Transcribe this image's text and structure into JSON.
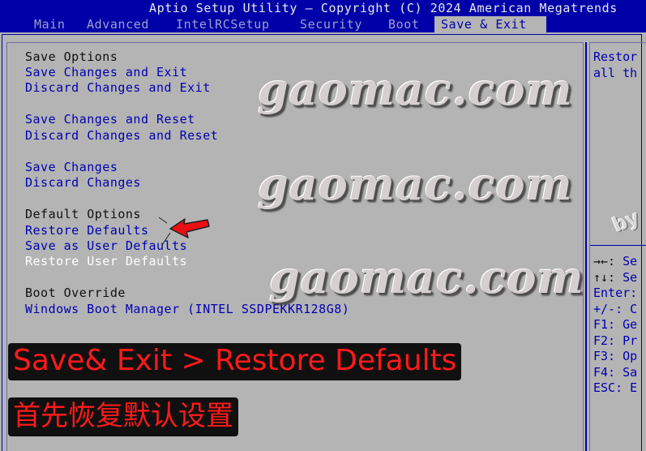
{
  "title": "Aptio Setup Utility – Copyright (C) 2024 American Megatrends",
  "tabs": [
    "Main",
    "Advanced",
    "IntelRCSetup",
    "Security",
    "Boot",
    "Save & Exit"
  ],
  "active_tab": "Save & Exit",
  "menu": {
    "save_options_header": "Save Options",
    "save_exit": "Save Changes and Exit",
    "discard_exit": "Discard Changes and Exit",
    "save_reset": "Save Changes and Reset",
    "discard_reset": "Discard Changes and Reset",
    "save_changes": "Save Changes",
    "discard_changes": "Discard Changes",
    "default_options_header": "Default Options",
    "restore_defaults": "Restore Defaults",
    "save_user_defaults": "Save as User Defaults",
    "restore_user_defaults": "Restore User Defaults",
    "boot_override_header": "Boot Override",
    "boot_device": "Windows Boot Manager (INTEL SSDPEKKR128G8)"
  },
  "help": {
    "line1": "Restor",
    "line2": "all th"
  },
  "keys": [
    {
      "key": "→←:",
      "desc": " Se"
    },
    {
      "key": "↑↓:",
      "desc": " Se"
    },
    {
      "key": "Enter:",
      "desc": ""
    },
    {
      "key": "+/-:",
      "desc": " C"
    },
    {
      "key": "F1:",
      "desc": " Ge"
    },
    {
      "key": "F2:",
      "desc": " Pr"
    },
    {
      "key": "F3:",
      "desc": " Op"
    },
    {
      "key": "F4:",
      "desc": " Sa"
    },
    {
      "key": "ESC:",
      "desc": " E"
    }
  ],
  "watermark": {
    "text": "gaomac.com",
    "by": "by"
  },
  "annotations": {
    "banner1": "Save& Exit > Restore Defaults",
    "banner2": "首先恢复默认设置"
  },
  "colors": {
    "header_bg": "#0000a8",
    "panel_bg": "#b4b4b4",
    "option_text": "#0000b0",
    "selected_text": "#ffffff",
    "annotation_red": "#ff1a1a"
  }
}
